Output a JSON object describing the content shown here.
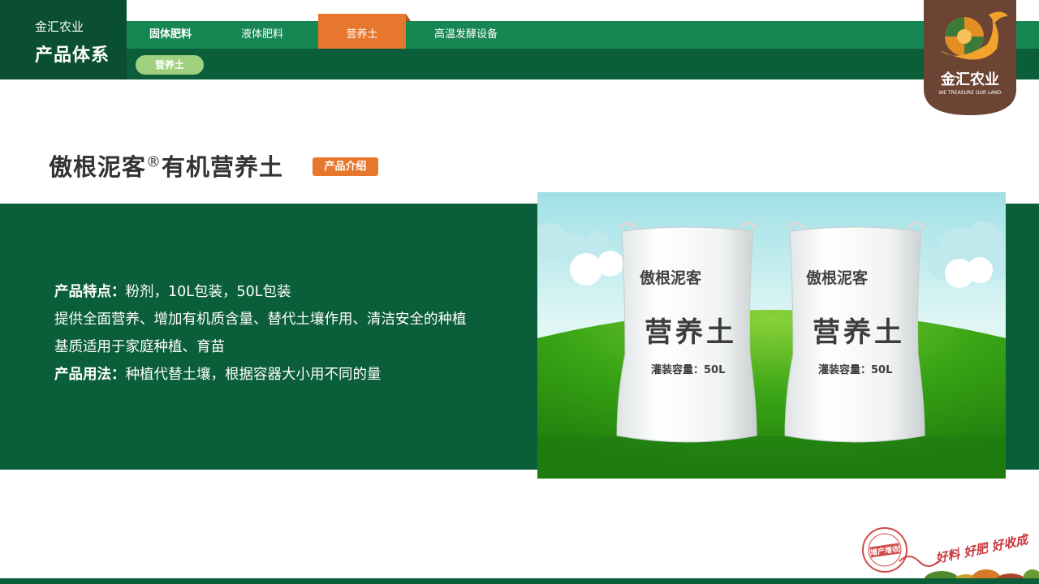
{
  "brand": {
    "company": "金汇农业",
    "section": "产品体系",
    "logo_name": "金汇农业",
    "logo_slogan": "WE TREASURE OUR LAND"
  },
  "nav": {
    "tabs": [
      {
        "label": "固体肥料"
      },
      {
        "label": "液体肥料"
      },
      {
        "label": "营养土"
      },
      {
        "label": "高温发酵设备"
      }
    ],
    "active_tab": "营养土",
    "subtab": "营养土"
  },
  "product": {
    "title_main": "傲根泥客",
    "title_mark": "®",
    "title_rest": "有机营养土",
    "intro_badge": "产品介绍",
    "features_label": "产品特点：",
    "features_value": "粉剂，10L包装，50L包装",
    "line2": "提供全面营养、增加有机质含量、替代土壤作用、清洁安全的种植",
    "line3": "基质适用于家庭种植、育苗",
    "usage_label": "产品用法：",
    "usage_value": "种植代替土壤，根据容器大小用不同的量"
  },
  "bag": {
    "brand": "傲根泥客",
    "name": "营养土",
    "capacity": "灌装容量：50L"
  },
  "footer": {
    "slogan": "好料 好肥 好收成",
    "stamp": "增产增收"
  },
  "colors": {
    "dark_green": "#0b5e3a",
    "tab_green": "#168653",
    "orange": "#e8772e",
    "light_green": "#9fd07e",
    "logo_brown": "#6b4433"
  }
}
